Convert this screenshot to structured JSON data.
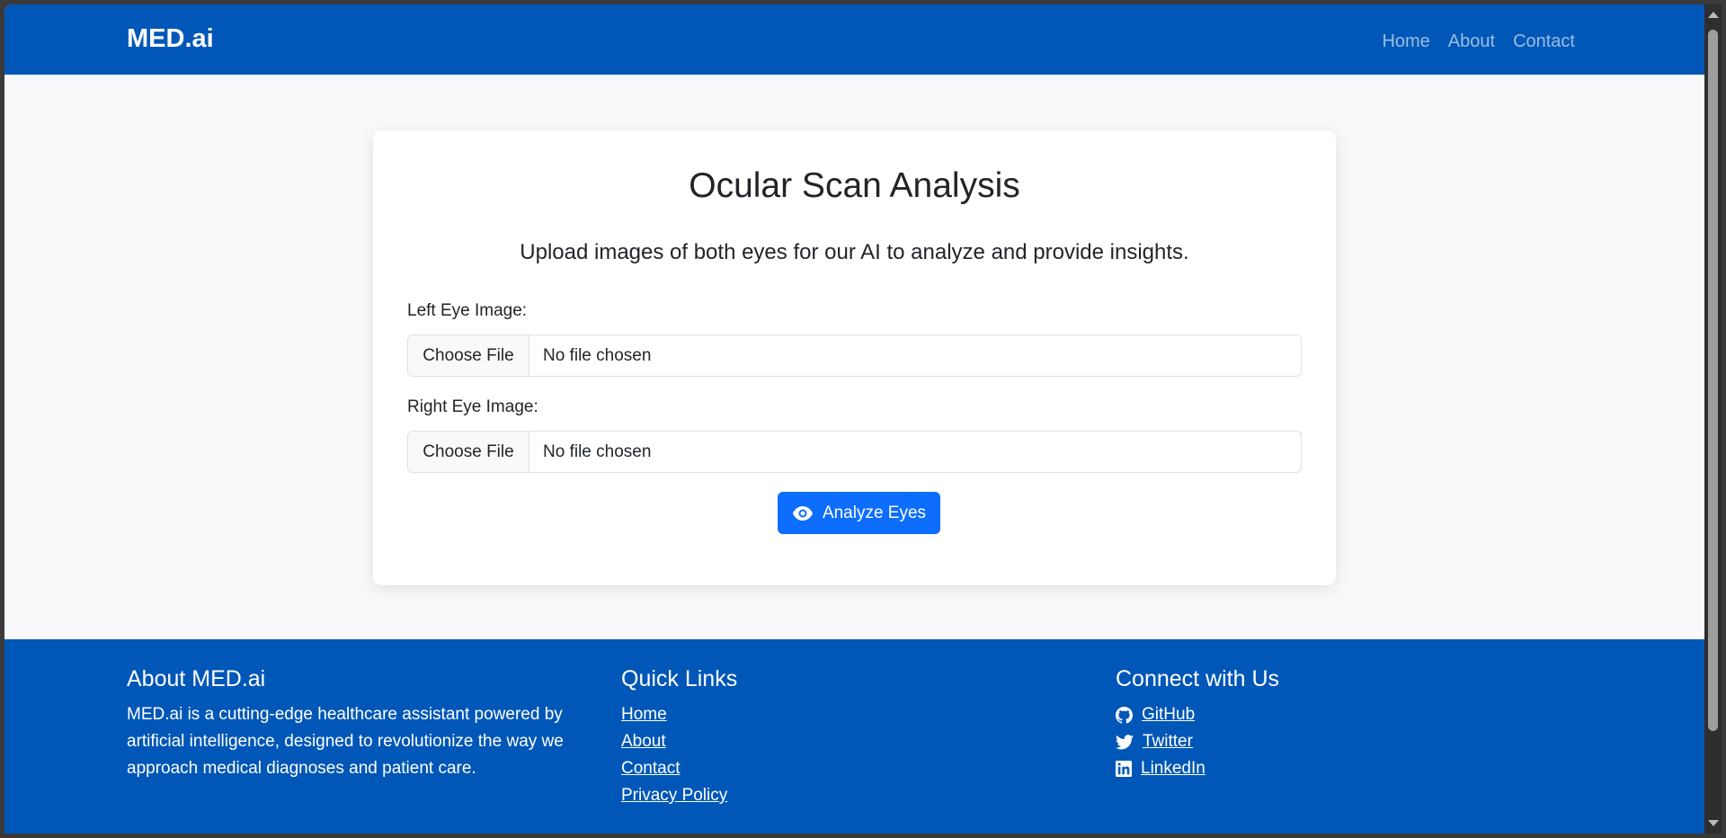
{
  "navbar": {
    "brand": "MED.ai",
    "links": [
      "Home",
      "About",
      "Contact"
    ]
  },
  "card": {
    "title": "Ocular Scan Analysis",
    "lead": "Upload images of both eyes for our AI to analyze and provide insights.",
    "left_label": "Left Eye Image:",
    "right_label": "Right Eye Image:",
    "choose_file": "Choose File",
    "no_file": "No file chosen",
    "analyze_button": "Analyze Eyes"
  },
  "footer": {
    "about_title": "About MED.ai",
    "about_text": "MED.ai is a cutting-edge healthcare assistant powered by artificial intelligence, designed to revolutionize the way we approach medical diagnoses and patient care.",
    "quick_title": "Quick Links",
    "quick_links": [
      "Home",
      "About",
      "Contact",
      "Privacy Policy"
    ],
    "connect_title": "Connect with Us",
    "social": [
      {
        "label": "GitHub",
        "icon": "github-icon"
      },
      {
        "label": "Twitter",
        "icon": "twitter-icon"
      },
      {
        "label": "LinkedIn",
        "icon": "linkedin-icon"
      }
    ]
  },
  "colors": {
    "primary": "#0057b7",
    "button": "#0d6efd",
    "background": "#f8f9fa"
  }
}
